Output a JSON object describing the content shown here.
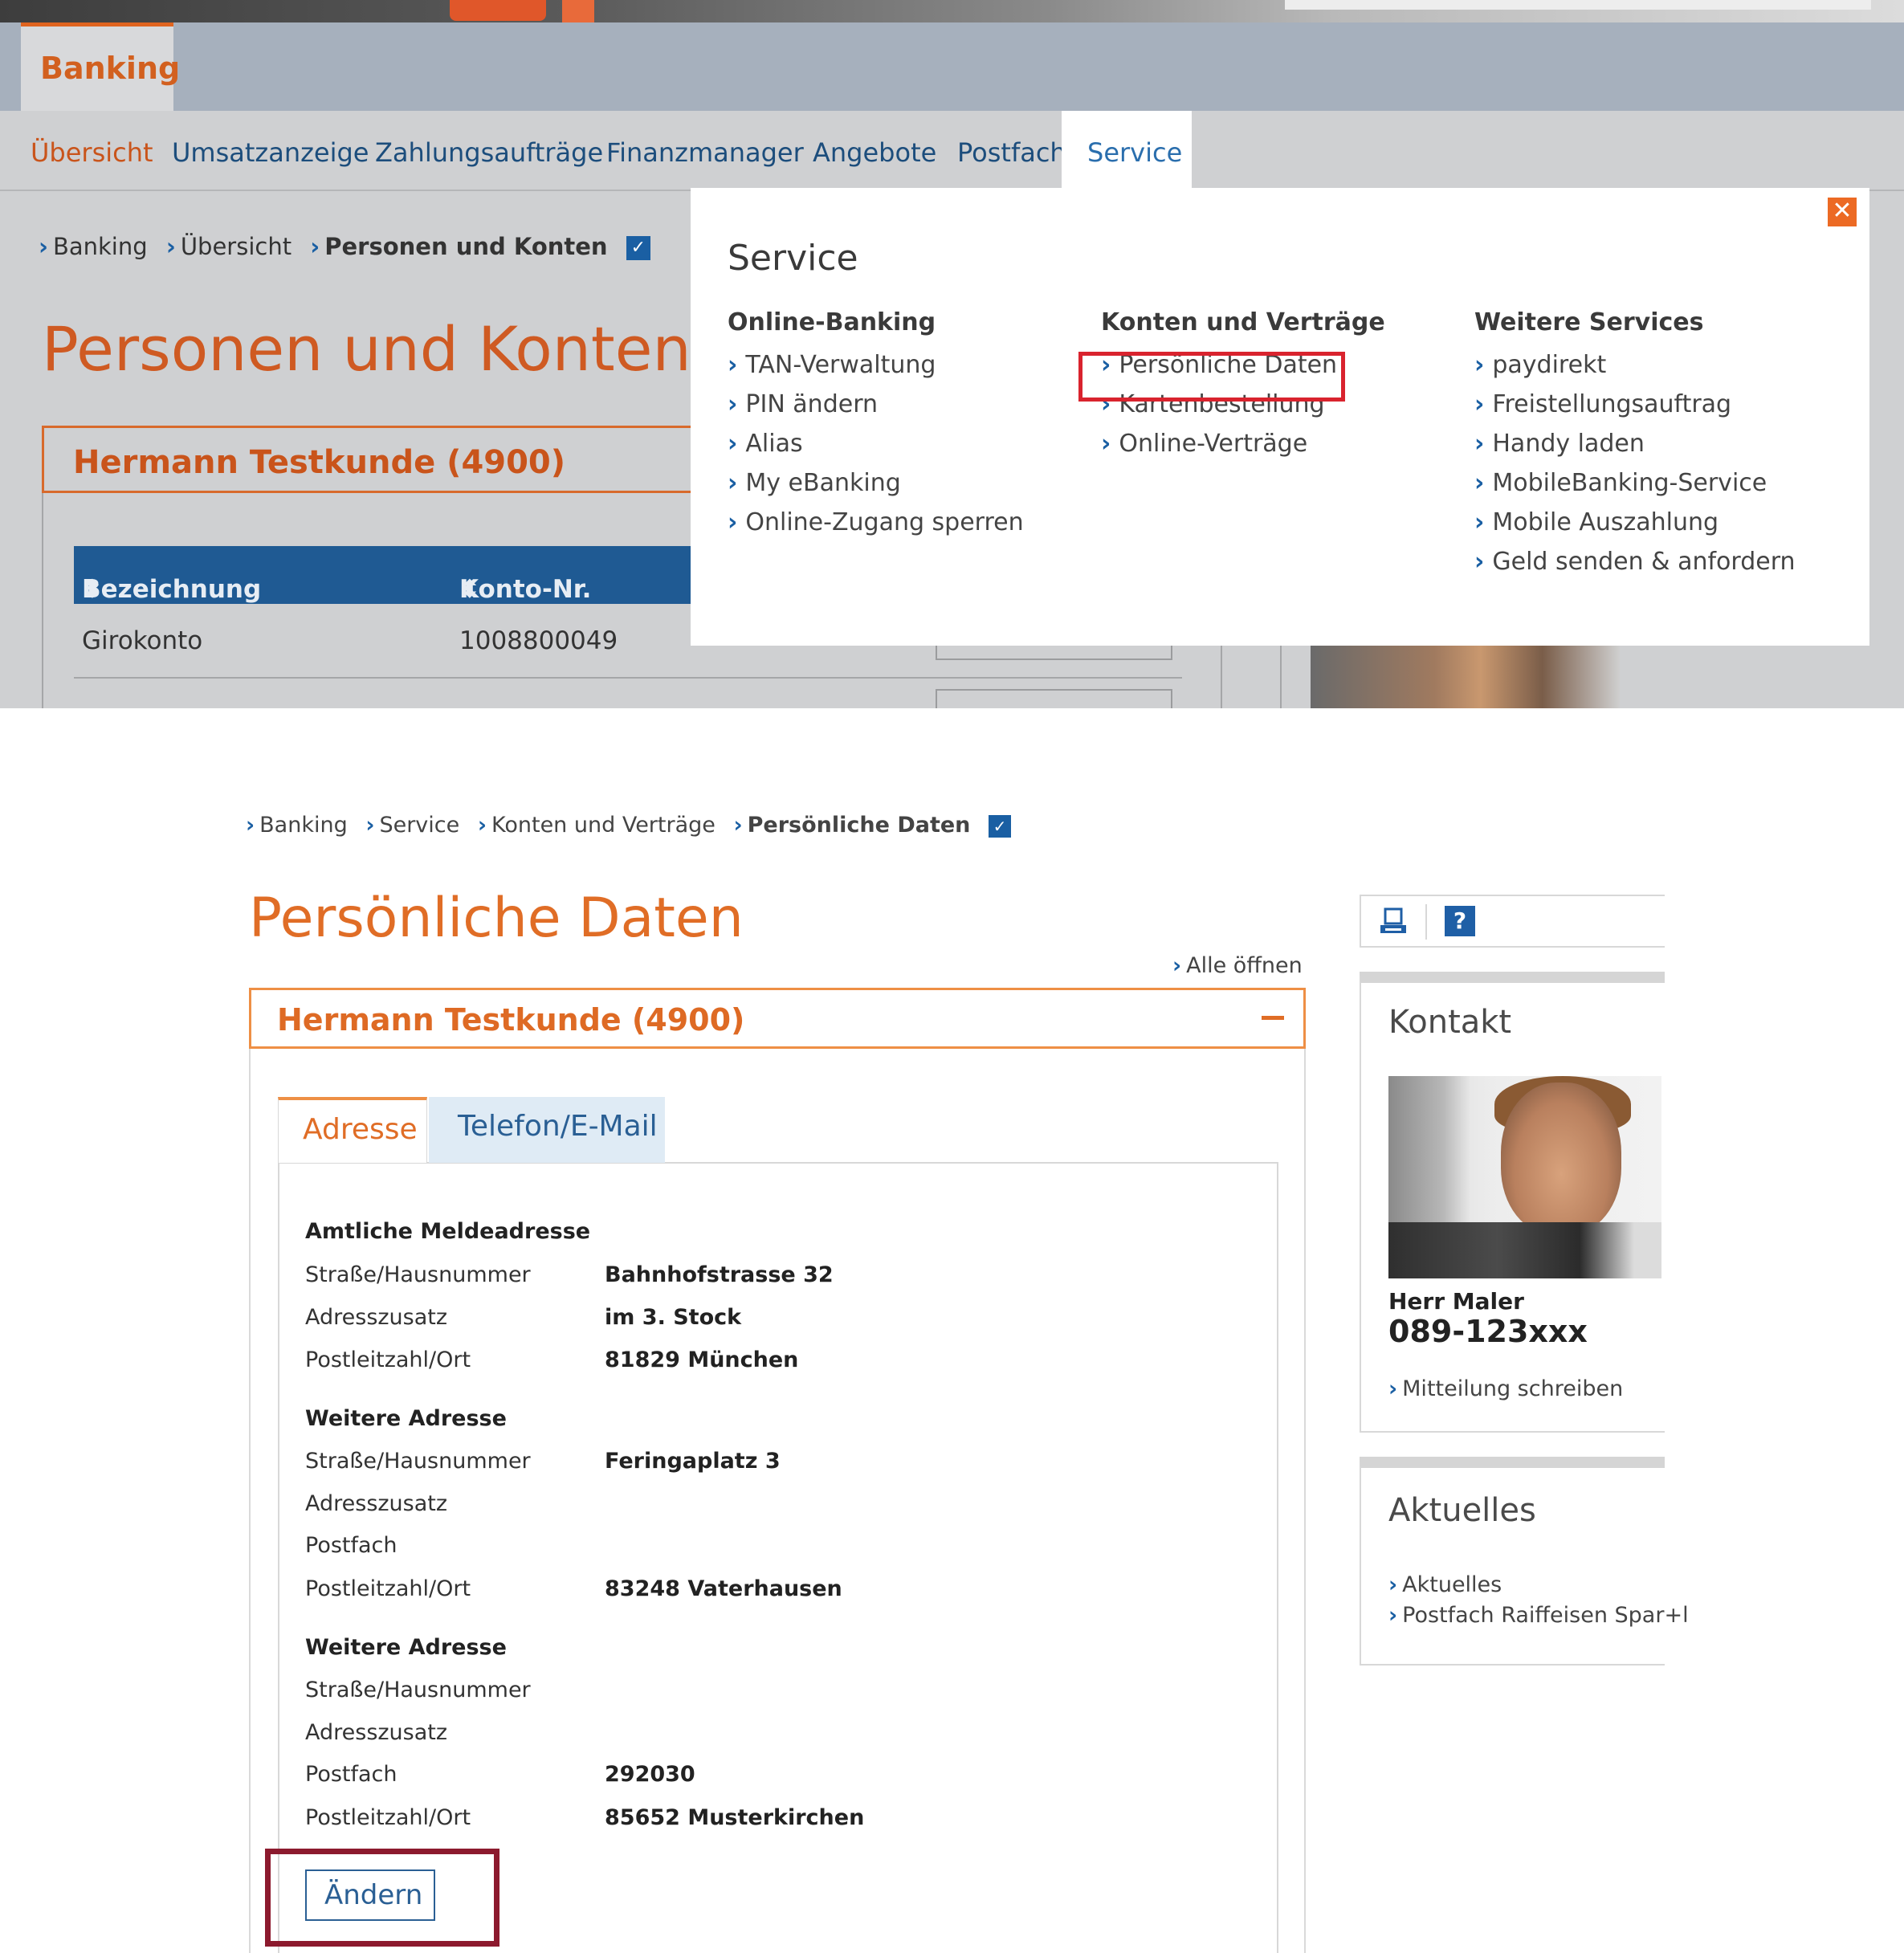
{
  "top": {
    "app_tab": "Banking",
    "nav": [
      "Übersicht",
      "Umsatzanzeige",
      "Zahlungsaufträge",
      "Finanzmanager",
      "Angebote",
      "Postfach",
      "Service"
    ],
    "breadcrumb": [
      "Banking",
      "Übersicht",
      "Personen und Konten"
    ],
    "page_title": "Personen und Konten",
    "account_holder": "Hermann Testkunde (4900)",
    "table_headers": [
      "Bezeichnung",
      "Konto-Nr."
    ],
    "table_row": {
      "bezeichnung": "Girokonto",
      "konto_nr": "1008800049"
    },
    "dropdown": {
      "title": "Service",
      "columns": [
        {
          "heading": "Online-Banking",
          "links": [
            "TAN-Verwaltung",
            "PIN ändern",
            "Alias",
            "My eBanking",
            "Online-Zugang sperren"
          ]
        },
        {
          "heading": "Konten und Verträge",
          "links": [
            "Persönliche Daten",
            "Kartenbestellung",
            "Online-Verträge"
          ]
        },
        {
          "heading": "Weitere Services",
          "links": [
            "paydirekt",
            "Freistellungsauftrag",
            "Handy laden",
            "MobileBanking-Service",
            "Mobile Auszahlung",
            "Geld senden & anfordern"
          ]
        }
      ]
    }
  },
  "bottom": {
    "breadcrumb": [
      "Banking",
      "Service",
      "Konten und Verträge",
      "Persönliche Daten"
    ],
    "page_title": "Persönliche Daten",
    "alle_oeffnen": "Alle öffnen",
    "account_holder": "Hermann Testkunde (4900)",
    "tabs": [
      "Adresse",
      "Telefon/E-Mail"
    ],
    "sections": [
      {
        "title": "Amtliche Meldeadresse",
        "rows": [
          {
            "label": "Straße/Hausnummer",
            "value": "Bahnhofstrasse 32"
          },
          {
            "label": "Adresszusatz",
            "value": "im 3. Stock"
          },
          {
            "label": "Postleitzahl/Ort",
            "value": "81829 München"
          }
        ]
      },
      {
        "title": "Weitere Adresse",
        "rows": [
          {
            "label": "Straße/Hausnummer",
            "value": "Feringaplatz 3"
          },
          {
            "label": "Adresszusatz",
            "value": ""
          },
          {
            "label": "Postfach",
            "value": ""
          },
          {
            "label": "Postleitzahl/Ort",
            "value": "83248 Vaterhausen"
          }
        ]
      },
      {
        "title": "Weitere Adresse",
        "rows": [
          {
            "label": "Straße/Hausnummer",
            "value": ""
          },
          {
            "label": "Adresszusatz",
            "value": ""
          },
          {
            "label": "Postfach",
            "value": "292030"
          },
          {
            "label": "Postleitzahl/Ort",
            "value": "85652 Musterkirchen"
          }
        ]
      }
    ],
    "button_change": "Ändern",
    "kontakt": {
      "title": "Kontakt",
      "name": "Herr Maler",
      "phone": "089-123xxx",
      "link": "Mitteilung schreiben"
    },
    "aktuelles": {
      "title": "Aktuelles",
      "links": [
        "Aktuelles",
        "Postfach Raiffeisen Spar+l"
      ]
    }
  }
}
